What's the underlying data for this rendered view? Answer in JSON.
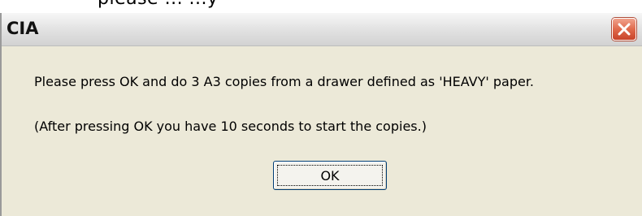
{
  "cropped_text": "please ... ...y",
  "dialog": {
    "title": "CIA",
    "close_icon": "close-icon",
    "message_line1": "Please press OK and do 3 A3 copies from a drawer defined as 'HEAVY' paper.",
    "message_line2": "(After pressing OK you have 10 seconds to start the copies.)",
    "ok_label": "OK"
  },
  "colors": {
    "dialog_bg": "#ece9d8",
    "close_button": "#e06a4c",
    "button_border": "#003c74"
  }
}
